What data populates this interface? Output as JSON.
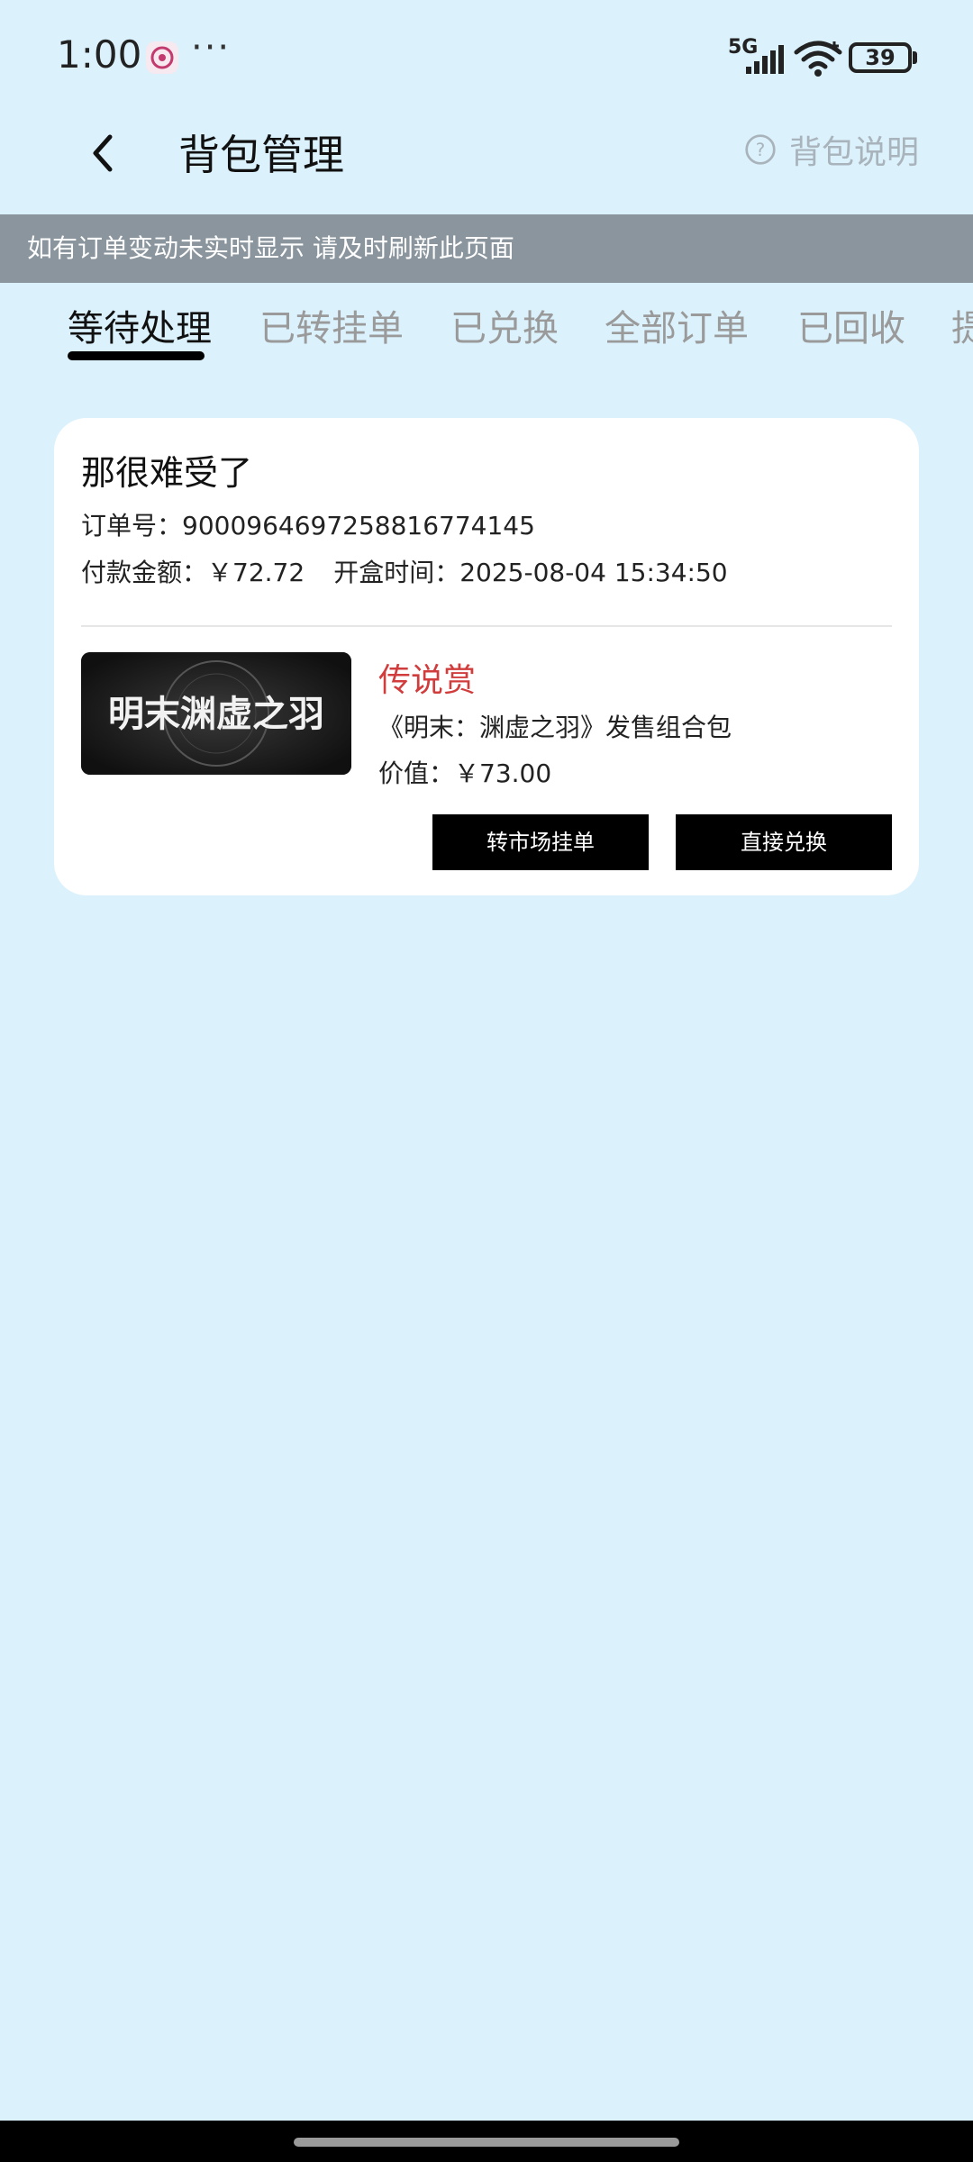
{
  "status_bar": {
    "time": "1:00",
    "more_dots": "···",
    "network": "5G",
    "battery": "39",
    "app_icon": "notification-app-icon",
    "signal_icon": "cellular-signal-icon",
    "wifi_icon": "wifi-icon"
  },
  "header": {
    "title": "背包管理",
    "help_label": "背包说明",
    "back_icon": "chevron-left-icon",
    "help_icon": "question-circle-icon"
  },
  "notice": {
    "text": "如有订单变动未实时显示 请及时刷新此页面"
  },
  "tabs": [
    {
      "label": "等待处理",
      "active": true
    },
    {
      "label": "已转挂单",
      "active": false
    },
    {
      "label": "已兑换",
      "active": false
    },
    {
      "label": "全部订单",
      "active": false
    },
    {
      "label": "已回收",
      "active": false
    },
    {
      "label": "提",
      "active": false
    }
  ],
  "order": {
    "title": "那很难受了",
    "order_no_label": "订单号：",
    "order_no": "9000964697258816774145",
    "paid_label": "付款金额：",
    "paid_amount": "￥72.72",
    "open_time_label": "开盒时间：",
    "open_time": "2025-08-04 15:34:50",
    "product": {
      "tier": "传说赏",
      "name": "《明末：渊虚之羽》发售组合包",
      "value_label": "价值：",
      "value": "￥73.00",
      "thumb_text": "明末渊虚之羽"
    },
    "buttons": {
      "listing": "转市场挂单",
      "redeem": "直接兑换"
    }
  },
  "colors": {
    "background": "#dbf1fc",
    "notice_bg": "#8a959d",
    "tier_red": "#d13d3d",
    "button_black": "#000000"
  }
}
